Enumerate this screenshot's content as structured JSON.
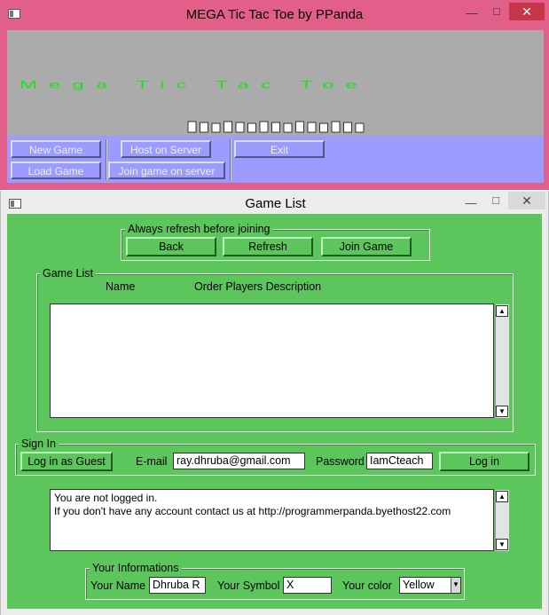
{
  "main_window": {
    "title": "MEGA Tic Tac Toe by PPanda",
    "banner_title": "Mega Tic Tac Toe",
    "buttons": {
      "new_game": "New Game",
      "load_game": "Load Game",
      "host_on_server": "Host on Server",
      "join_game_on_server": "Join game on server",
      "exit": "Exit"
    }
  },
  "game_list_window": {
    "title": "Game List",
    "refresh_group": {
      "legend": "Always refresh before joining",
      "back": "Back",
      "refresh": "Refresh",
      "join_game": "Join Game"
    },
    "game_list_group": {
      "legend": "Game List",
      "columns": [
        "Name",
        "Order Players Description"
      ],
      "rows": []
    },
    "sign_in": {
      "legend": "Sign In",
      "guest_button": "Log in as Guest",
      "email_label": "E-mail",
      "email_value": "ray.dhruba@gmail.com",
      "password_label": "Password",
      "password_value": "IamCteach",
      "login_button": "Log in"
    },
    "status_lines": [
      "You are not logged in.",
      "If you don't have any account contact us at http://programmerpanda.byethost22.com"
    ],
    "your_info": {
      "legend": "Your Informations",
      "name_label": "Your Name",
      "name_value": "Dhruba R",
      "symbol_label": "Your Symbol",
      "symbol_value": "X",
      "color_label": "Your color",
      "color_value": "Yellow"
    }
  },
  "colors": {
    "main_frame": "#e15f88",
    "banner_bg": "#ababab",
    "banner_text": "#18e518",
    "button_panel": "#9c9cff",
    "dialog_bg": "#5cc65c"
  }
}
